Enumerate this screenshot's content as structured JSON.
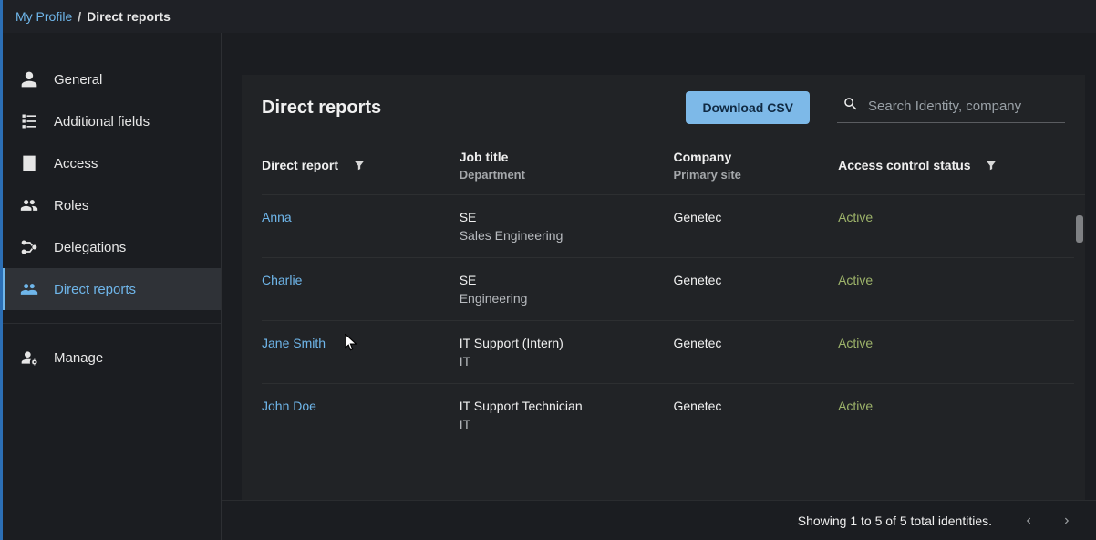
{
  "breadcrumb": {
    "root": "My Profile",
    "sep": "/",
    "current": "Direct reports"
  },
  "sidebar": {
    "group1": [
      {
        "id": "general",
        "label": "General",
        "icon": "user-icon"
      },
      {
        "id": "additional-fields",
        "label": "Additional fields",
        "icon": "list-icon"
      },
      {
        "id": "access",
        "label": "Access",
        "icon": "building-icon"
      },
      {
        "id": "roles",
        "label": "Roles",
        "icon": "users-icon"
      },
      {
        "id": "delegations",
        "label": "Delegations",
        "icon": "delegation-icon"
      },
      {
        "id": "direct-reports",
        "label": "Direct reports",
        "icon": "team-icon",
        "active": true
      }
    ],
    "group2": [
      {
        "id": "manage",
        "label": "Manage",
        "icon": "user-cog-icon"
      }
    ]
  },
  "panel": {
    "title": "Direct reports",
    "download_label": "Download CSV",
    "search_placeholder": "Search Identity, company"
  },
  "table": {
    "headers": {
      "c1": "Direct report",
      "c2": "Job title",
      "c2sub": "Department",
      "c3": "Company",
      "c3sub": "Primary site",
      "c4": "Access control status"
    },
    "rows": [
      {
        "name": "Anna",
        "job": "SE",
        "dept": "Sales Engineering",
        "company": "Genetec",
        "status": "Active"
      },
      {
        "name": "Charlie",
        "job": "SE",
        "dept": "Engineering",
        "company": "Genetec",
        "status": "Active"
      },
      {
        "name": "Jane Smith",
        "job": "IT Support (Intern)",
        "dept": "IT",
        "company": "Genetec",
        "status": "Active"
      },
      {
        "name": "John Doe",
        "job": "IT Support Technician",
        "dept": "IT",
        "company": "Genetec",
        "status": "Active"
      }
    ]
  },
  "footer": {
    "summary": "Showing 1 to 5 of 5 total identities."
  }
}
